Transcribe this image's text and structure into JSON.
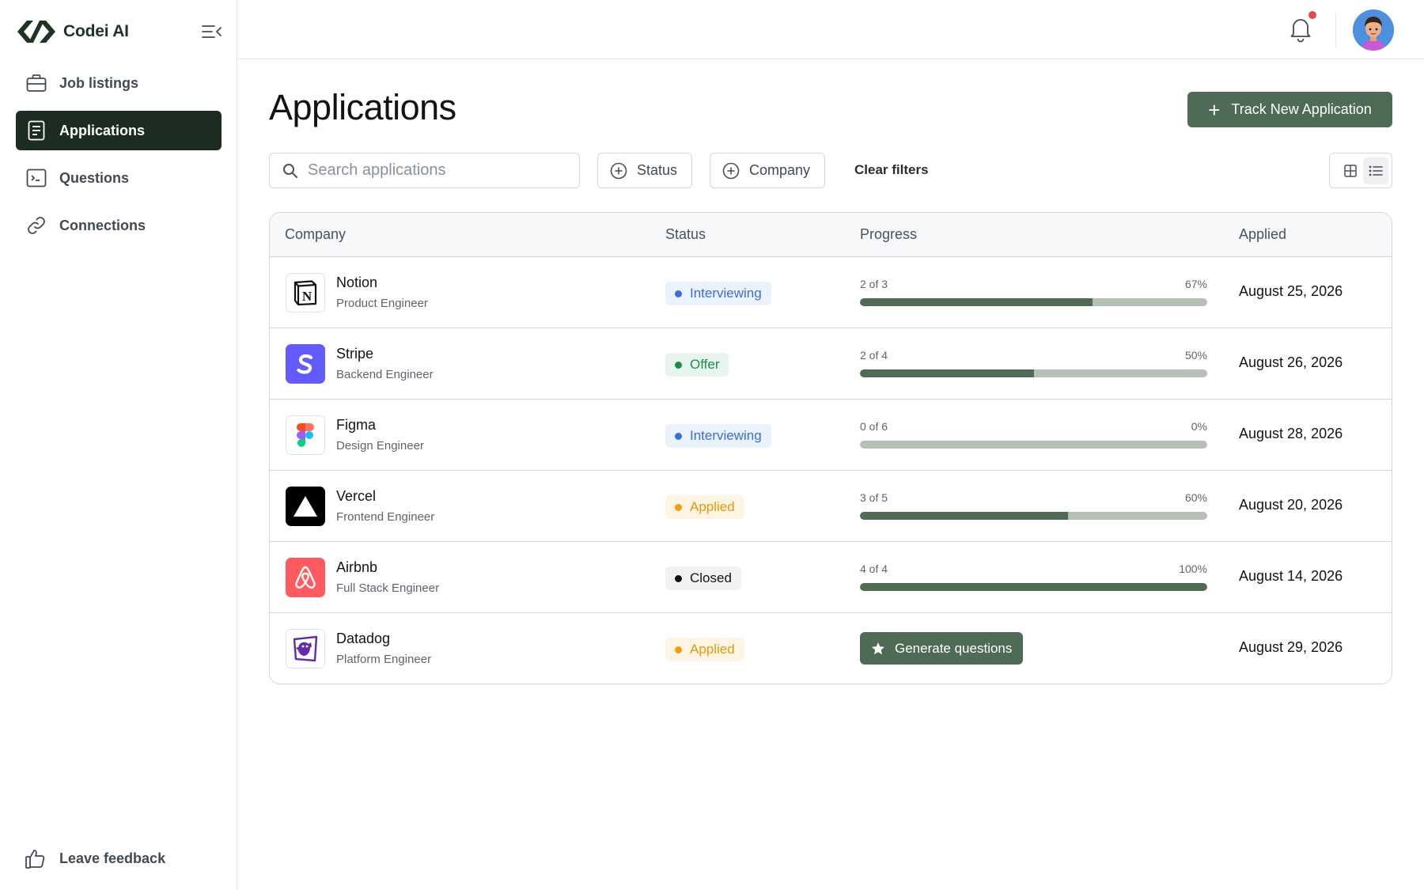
{
  "brand": {
    "name": "Codei AI",
    "logo_icon": "codei-logo-icon"
  },
  "sidebar": {
    "items": [
      {
        "label": "Job listings",
        "icon": "briefcase-icon",
        "active": false
      },
      {
        "label": "Applications",
        "icon": "document-icon",
        "active": true
      },
      {
        "label": "Questions",
        "icon": "terminal-icon",
        "active": false
      },
      {
        "label": "Connections",
        "icon": "link-icon",
        "active": false
      }
    ],
    "feedback_label": "Leave feedback"
  },
  "topbar": {
    "has_notification": true
  },
  "main": {
    "title": "Applications",
    "track_button": "Track New Application",
    "search_placeholder": "Search applications",
    "filters": {
      "status": "Status",
      "company": "Company",
      "clear": "Clear filters"
    },
    "view_mode": "list"
  },
  "table": {
    "headers": {
      "company": "Company",
      "status": "Status",
      "progress": "Progress",
      "applied": "Applied"
    },
    "rows": [
      {
        "company": "Notion",
        "role": "Product Engineer",
        "status": "Interviewing",
        "status_key": "interviewing",
        "progress_text": "2 of 3",
        "percent_text": "67%",
        "progress": 0.67,
        "applied": "August 25, 2026"
      },
      {
        "company": "Stripe",
        "role": "Backend Engineer",
        "status": "Offer",
        "status_key": "offer",
        "progress_text": "2 of 4",
        "percent_text": "50%",
        "progress": 0.5,
        "applied": "August 26, 2026"
      },
      {
        "company": "Figma",
        "role": "Design Engineer",
        "status": "Interviewing",
        "status_key": "interviewing",
        "progress_text": "0 of 6",
        "percent_text": "0%",
        "progress": 0,
        "applied": "August 28, 2026"
      },
      {
        "company": "Vercel",
        "role": "Frontend Engineer",
        "status": "Applied",
        "status_key": "applied",
        "progress_text": "3 of 5",
        "percent_text": "60%",
        "progress": 0.6,
        "applied": "August 20, 2026"
      },
      {
        "company": "Airbnb",
        "role": "Full Stack Engineer",
        "status": "Closed",
        "status_key": "closed",
        "progress_text": "4 of 4",
        "percent_text": "100%",
        "progress": 1.0,
        "applied": "August 14, 2026"
      },
      {
        "company": "Datadog",
        "role": "Platform Engineer",
        "status": "Applied",
        "status_key": "applied",
        "generate_label": "Generate questions",
        "applied": "August 29, 2026"
      }
    ]
  },
  "colors": {
    "accent": "#4f6b55",
    "active_nav": "#1c2c20"
  }
}
